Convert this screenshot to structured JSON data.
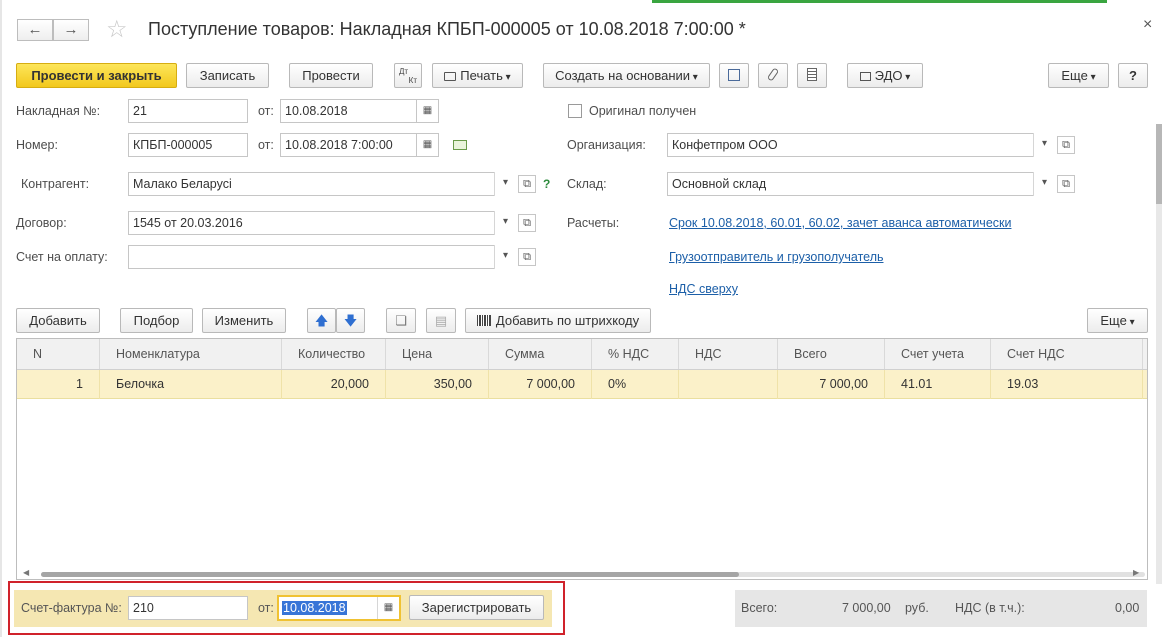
{
  "window": {
    "title": "Поступление товаров: Накладная КПБП-000005 от 10.08.2018 7:00:00 *",
    "back_glyph": "←",
    "forward_glyph": "→",
    "star_glyph": "☆",
    "close_glyph": "×"
  },
  "toolbar": {
    "post_close": "Провести и закрыть",
    "save": "Записать",
    "post": "Провести",
    "dtkt_line1": "Дт",
    "dtkt_line2": "Кт",
    "print": "Печать",
    "create_based": "Создать на основании",
    "edo": "ЭДО",
    "more": "Еще",
    "help": "?"
  },
  "form": {
    "invoice_label": "Накладная №:",
    "invoice_value": "21",
    "from_label": "от:",
    "invoice_date": "10.08.2018",
    "original_label": "Оригинал получен",
    "number_label": "Номер:",
    "number_value": "КПБП-000005",
    "number_date": "10.08.2018  7:00:00",
    "org_label": "Организация:",
    "org_value": "Конфетпром ООО",
    "counterparty_label": "Контрагент:",
    "counterparty_value": "Малако Беларусi",
    "question": "?",
    "warehouse_label": "Склад:",
    "warehouse_value": "Основной склад",
    "contract_label": "Договор:",
    "contract_value": "1545 от 20.03.2016",
    "settlements_label": "Расчеты:",
    "settlements_link": "Срок 10.08.2018, 60.01, 60.02, зачет аванса автоматически",
    "payment_label": "Счет на оплату:",
    "payment_value": "",
    "shipper_link": "Грузоотправитель и грузополучатель",
    "vat_link": "НДС сверху"
  },
  "table_toolbar": {
    "add": "Добавить",
    "select": "Подбор",
    "change": "Изменить",
    "barcode": "Добавить по штрихкоду",
    "more": "Еще"
  },
  "table": {
    "headers": {
      "n": "N",
      "item": "Номенклатура",
      "qty": "Количество",
      "price": "Цена",
      "sum": "Сумма",
      "vat_pct": "% НДС",
      "vat": "НДС",
      "total": "Всего",
      "account": "Счет учета",
      "vat_account": "Счет НДС"
    },
    "rows": [
      {
        "n": "1",
        "item": "Белочка",
        "qty": "20,000",
        "price": "350,00",
        "sum": "7 000,00",
        "vat_pct": "0%",
        "vat": "",
        "total": "7 000,00",
        "account": "41.01",
        "vat_account": "19.03"
      }
    ]
  },
  "footer": {
    "sf_label": "Счет-фактура №:",
    "sf_value": "210",
    "sf_from": "от:",
    "sf_date": "10.08.2018",
    "register": "Зарегистрировать",
    "total_label": "Всего:",
    "total_value": "7 000,00",
    "currency": "руб.",
    "vat_incl_label": "НДС (в т.ч.):",
    "vat_incl_value": "0,00"
  },
  "colors": {
    "primary_button": "#f2c81d",
    "selected_row": "#fbf1c9",
    "link": "#1c5fa8",
    "highlight_border": "#d0222b"
  }
}
